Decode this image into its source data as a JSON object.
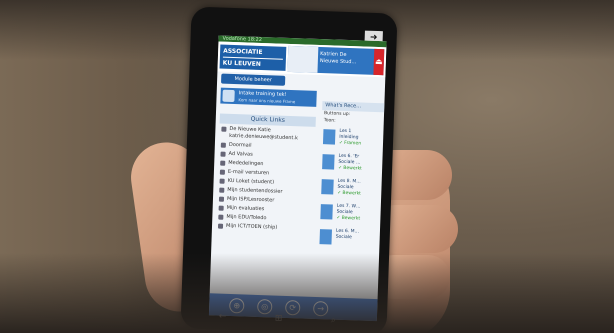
{
  "screen": {
    "top_bar": "Vodafone 18:22",
    "logo_line1": "ASSOCIATIE",
    "logo_line2": "KU LEUVEN",
    "banner_text": "Katrien De Nieuwe Stud…",
    "banner_close": "⏏",
    "module_button": "Module beheer",
    "training": {
      "line1": "Intake training tek!",
      "line2": "Kom naar ons nieuwe Frame"
    },
    "quick_links_title": "Quick Links",
    "quick_links": [
      "De Nieuwe Katie",
      "katrie.denieuwe@student.k",
      "Doormail",
      "Ad Valvas",
      "Mededelingen",
      "E-mail versturen",
      "KU Loket (student)",
      "Mijn studentendossier",
      "Mijn ISP/Lesrooster",
      "Mijn evaluaties",
      "Mijn EDU/Toledo",
      "Mijn ICT/TOEN (ship)"
    ],
    "whats_new_title": "What's Rece…",
    "buttons_up": "Buttons up:",
    "toon": "Toon:",
    "lessons": [
      {
        "title": "Les 1",
        "line": "Inleiding",
        "status": "✓ Framen"
      },
      {
        "title": "Les 6. 'Er",
        "line": "Sociale …",
        "status": "✓ Bewerkt"
      },
      {
        "title": "Les 8. M…",
        "line": "Sociale",
        "status": "✓ Bewerkt"
      },
      {
        "title": "Les 7. W…",
        "line": "Sociale",
        "status": "✓ Bewerkt"
      },
      {
        "title": "Les 6. M…",
        "line": "Sociale",
        "status": ""
      }
    ],
    "appbar_buttons": [
      "⊕",
      "◎",
      "⟳",
      "→"
    ],
    "nav_icons": [
      "←",
      "⊞",
      "⌕"
    ],
    "corner_button": "➜"
  }
}
